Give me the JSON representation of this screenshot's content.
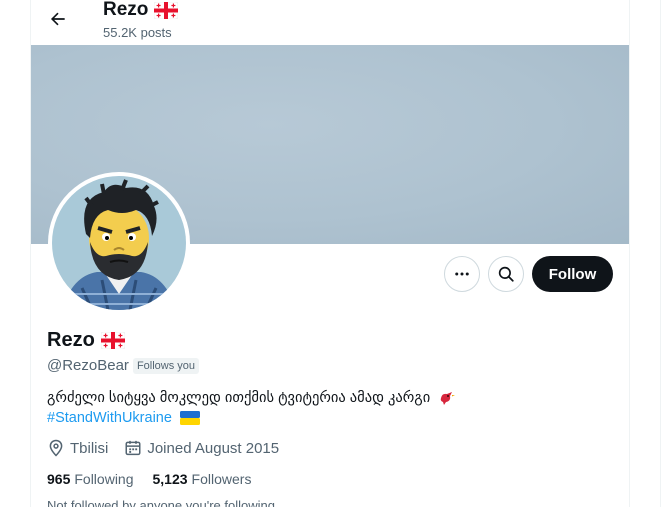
{
  "header": {
    "name": "Rezo",
    "posts_count": "55.2K posts"
  },
  "profile": {
    "name": "Rezo",
    "handle": "@RezoBear",
    "follows_you_badge": "Follows you",
    "bio_text": "გრძელი სიტყვა მოკლედ ითქმის ტვიტერია ამად კარგი",
    "hashtag": "#StandWithUkraine",
    "location": "Tbilisi",
    "joined": "Joined August 2015",
    "following_count": "965",
    "following_label": "Following",
    "followers_count": "5,123",
    "followers_label": "Followers",
    "not_followed_text": "Not followed by anyone you're following"
  },
  "actions": {
    "follow_label": "Follow"
  },
  "colors": {
    "accent": "#1d9bf0",
    "follow_bg": "#0f1419",
    "muted_text": "#536471",
    "banner": "#aec2d0"
  },
  "icons": [
    "back-arrow-icon",
    "georgia-flag-icon",
    "more-icon",
    "search-icon",
    "location-pin-icon",
    "calendar-icon",
    "bird-emoji-icon",
    "ukraine-flag-icon"
  ]
}
